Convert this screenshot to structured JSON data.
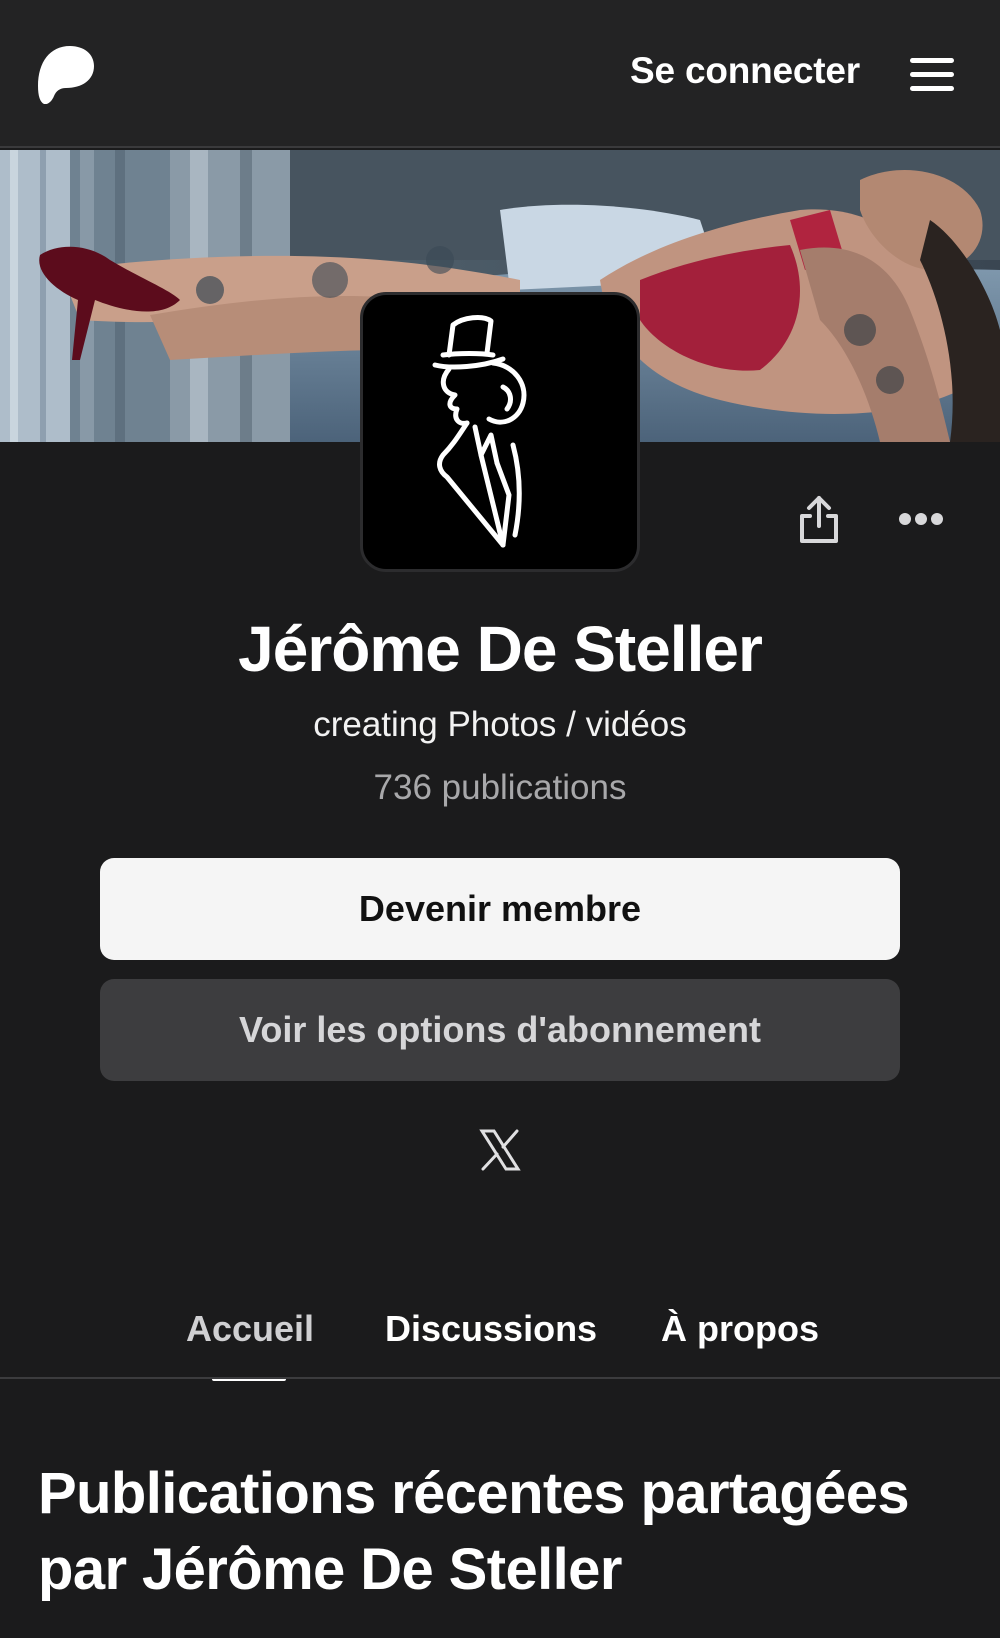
{
  "header": {
    "signin_label": "Se connecter"
  },
  "profile": {
    "name": "Jérôme De Steller",
    "tagline": "creating Photos / vidéos",
    "posts_count": "736 publications"
  },
  "actions": {
    "join_label": "Devenir membre",
    "options_label": "Voir les options d'abonnement"
  },
  "tabs": [
    {
      "label": "Accueil",
      "active": true
    },
    {
      "label": "Discussions",
      "active": false
    },
    {
      "label": "À propos",
      "active": false
    }
  ],
  "section": {
    "title": "Publications récentes partagées par Jérôme De Steller"
  },
  "colors": {
    "background": "#1b1b1c",
    "header": "#232324",
    "primary_button": "#f5f5f5",
    "secondary_button": "#3d3d3f",
    "accent_lingerie": "#a3203b"
  },
  "icons": [
    "patreon-logo-icon",
    "hamburger-menu-icon",
    "share-icon",
    "more-options-icon",
    "x-social-icon"
  ]
}
